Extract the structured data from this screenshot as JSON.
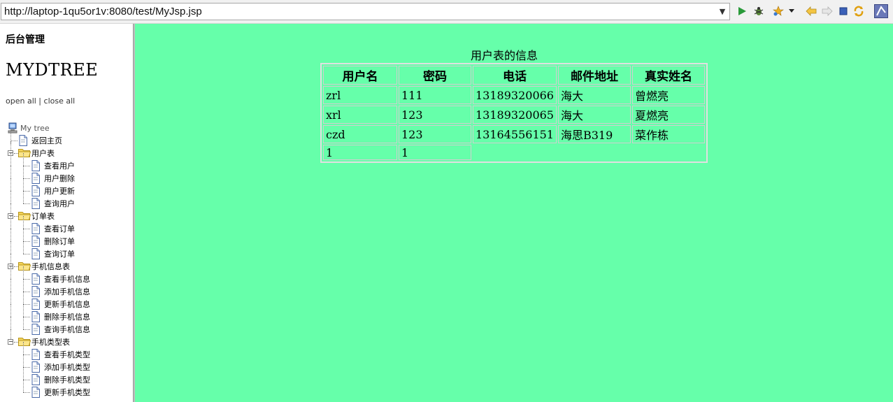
{
  "browser": {
    "url": "http://laptop-1qu5or1v:8080/test/MyJsp.jsp"
  },
  "sidebar": {
    "title": "后台管理",
    "tree_name": "MYDTREE",
    "open_all": "open all",
    "separator": " | ",
    "close_all": "close all",
    "root": "My tree",
    "home": "返回主页",
    "groups": [
      {
        "label": "用户表",
        "items": [
          "查看用户",
          "用户删除",
          "用户更新",
          "查询用户"
        ]
      },
      {
        "label": "订单表",
        "items": [
          "查看订单",
          "删除订单",
          "查询订单"
        ]
      },
      {
        "label": "手机信息表",
        "items": [
          "查看手机信息",
          "添加手机信息",
          "更新手机信息",
          "删除手机信息",
          "查询手机信息"
        ]
      },
      {
        "label": "手机类型表",
        "items": [
          "查看手机类型",
          "添加手机类型",
          "删除手机类型",
          "更新手机类型"
        ]
      }
    ]
  },
  "main": {
    "caption": "用户表的信息",
    "headers": [
      "用户名",
      "密码",
      "电话",
      "邮件地址",
      "真实姓名"
    ],
    "rows": [
      [
        "zrl",
        "111",
        "13189320066",
        "海大",
        "曾燃亮"
      ],
      [
        "xrl",
        "123",
        "13189320065",
        "海大",
        "夏燃亮"
      ],
      [
        "czd",
        "123",
        "13164556151",
        "海思B319",
        "菜作栋"
      ]
    ],
    "pager": [
      "1",
      "1"
    ]
  },
  "colors": {
    "main_bg": "#66ffaa",
    "folder": "#f5d55b"
  }
}
